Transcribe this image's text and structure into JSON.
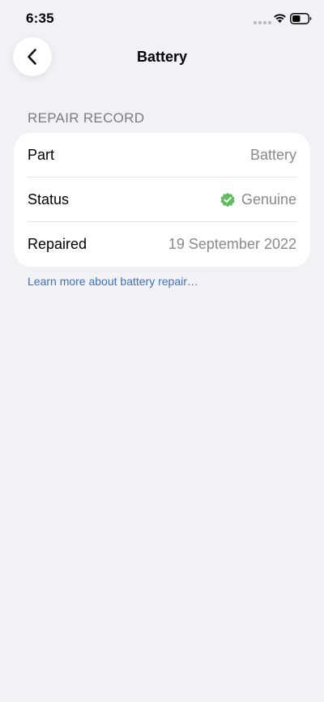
{
  "status_bar": {
    "time": "6:35",
    "icons": [
      "signal-dots-icon",
      "wifi-icon",
      "battery-icon"
    ]
  },
  "nav": {
    "back_icon": "chevron-left-icon",
    "title": "Battery"
  },
  "section": {
    "header": "REPAIR RECORD",
    "rows": [
      {
        "label": "Part",
        "value": "Battery"
      },
      {
        "label": "Status",
        "value": "Genuine",
        "icon": "verified-check-icon",
        "icon_color": "#5fbd5f"
      },
      {
        "label": "Repaired",
        "value": "19 September 2022"
      }
    ]
  },
  "link": {
    "text": "Learn more about battery repair…",
    "color": "#3a72c8"
  },
  "colors": {
    "background": "#f1f1f6",
    "card": "#ffffff",
    "secondary_text": "#8a8a8e"
  }
}
